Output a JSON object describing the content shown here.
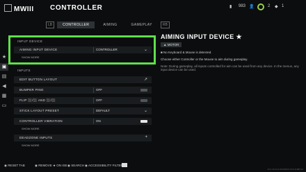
{
  "header": {
    "logo_text": "MWIII",
    "title": "CONTROLLER",
    "status_items": [
      "983",
      "2",
      "1"
    ]
  },
  "tabs": [
    {
      "label": "CONTROLLER",
      "active": true
    },
    {
      "label": "AIMING",
      "active": false
    },
    {
      "label": "GAMEPLAY",
      "active": false
    }
  ],
  "tab_keys": {
    "left": "LB",
    "right": "RB"
  },
  "sections": {
    "input_device": "INPUT DEVICE",
    "inputs": "INPUTS"
  },
  "rows": {
    "aiming_input": {
      "label": "AIMING INPUT DEVICE",
      "value": "CONTROLLER"
    },
    "edit_layout": {
      "label": "EDIT BUTTON LAYOUT"
    },
    "bumper_ping": {
      "label": "BUMPER PING",
      "value": "OFF"
    },
    "flip": {
      "label": "FLIP ⬛/⬛ AND ⬛/⬛",
      "value": "OFF"
    },
    "stick_layout": {
      "label": "STICK LAYOUT PRESET",
      "value": "DEFAULT"
    },
    "vibration": {
      "label": "CONTROLLER VIBRATION",
      "value": "ON"
    },
    "deadzone": {
      "label": "DEADZONE INPUTS"
    }
  },
  "show_more": "SHOW MORE",
  "info": {
    "title": "AIMING INPUT DEVICE ★",
    "badge": "MOTOR",
    "line1": "No Keyboard & Mouse is detected.",
    "line2": "Choose either Controller or the Mouse to aim during gameplay.",
    "line3": "Note: During gameplay, all inputs controlled for aim can be used from any device. In the menus, any input device can be used."
  },
  "footer": {
    "reset": "RESET TAB",
    "remove": "REMOVE ★ ON ISE",
    "search": "SEARCH",
    "accessibility": "ACCESSIBILITY FILTER",
    "version": "10.1.19.14.4.0/13/2023.3;5.6;11983;12"
  }
}
